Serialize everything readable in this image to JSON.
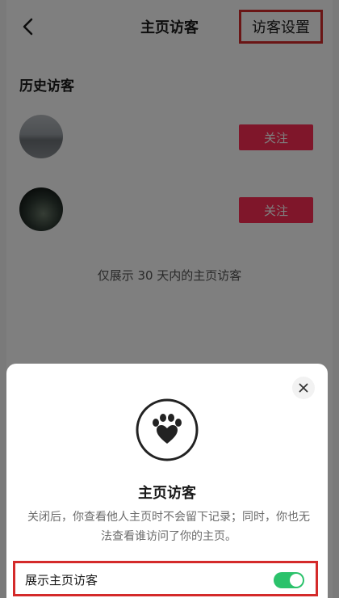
{
  "nav": {
    "title": "主页访客",
    "back_icon": "chevron-left-icon",
    "action_label": "访客设置"
  },
  "history": {
    "title": "历史访客",
    "visitors": [
      {
        "avatar": "avatar-landscape",
        "follow_label": "关注"
      },
      {
        "avatar": "avatar-night-street",
        "follow_label": "关注"
      }
    ],
    "footnote": "仅展示 30 天内的主页访客"
  },
  "sheet": {
    "close_icon": "close-icon",
    "emblem_icon": "paw-heart-icon",
    "title": "主页访客",
    "description": "关闭后，你查看他人主页时不会留下记录；同时，你也无法查看谁访问了你的主页。",
    "setting": {
      "label": "展示主页访客",
      "toggle_on": true
    }
  },
  "colors": {
    "follow_button": "#fe2c55",
    "highlight_box": "#d42a2a",
    "toggle_on": "#2bc26b"
  }
}
